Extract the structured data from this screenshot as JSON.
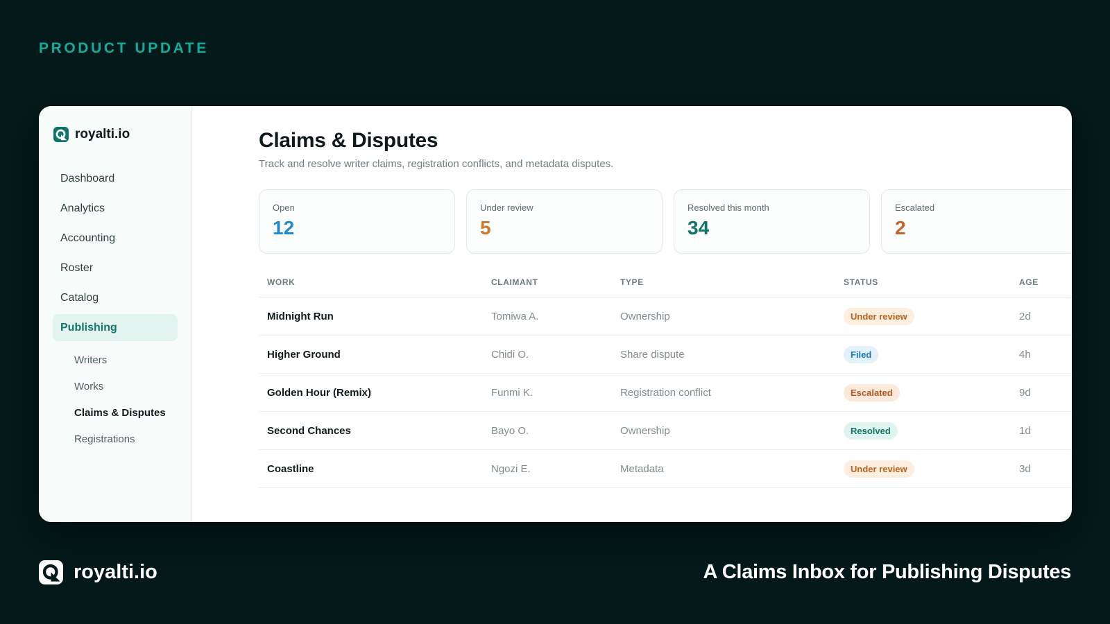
{
  "eyebrow": "PRODUCT UPDATE",
  "colors": {
    "background": "#04191a",
    "accent": "#14ac9b",
    "open": "#2189cf",
    "under_review": "#d0782b",
    "resolved": "#0f7469",
    "escalated": "#c2672e"
  },
  "brand": {
    "name": "royalti.io",
    "logo_icon": "brand-logo-icon"
  },
  "sidebar": {
    "items": [
      {
        "label": "Dashboard"
      },
      {
        "label": "Analytics"
      },
      {
        "label": "Accounting"
      },
      {
        "label": "Roster"
      },
      {
        "label": "Catalog"
      },
      {
        "label": "Publishing",
        "active": true
      }
    ],
    "subitems": [
      {
        "label": "Writers"
      },
      {
        "label": "Works"
      },
      {
        "label": "Claims & Disputes",
        "current": true
      },
      {
        "label": "Registrations"
      }
    ]
  },
  "page": {
    "title": "Claims & Disputes",
    "subtitle": "Track and resolve writer claims, registration conflicts, and metadata disputes."
  },
  "stats": [
    {
      "label": "Open",
      "value": "12"
    },
    {
      "label": "Under review",
      "value": "5"
    },
    {
      "label": "Resolved this month",
      "value": "34"
    },
    {
      "label": "Escalated",
      "value": "2"
    }
  ],
  "table": {
    "headers": {
      "work": "WORK",
      "claimant": "CLAIMANT",
      "type": "TYPE",
      "status": "STATUS",
      "age": "AGE"
    },
    "rows": [
      {
        "work": "Midnight Run",
        "claimant": "Tomiwa A.",
        "type": "Ownership",
        "status": "Under review",
        "age": "2d"
      },
      {
        "work": "Higher Ground",
        "claimant": "Chidi O.",
        "type": "Share dispute",
        "status": "Filed",
        "age": "4h"
      },
      {
        "work": "Golden Hour (Remix)",
        "claimant": "Funmi K.",
        "type": "Registration conflict",
        "status": "Escalated",
        "age": "9d"
      },
      {
        "work": "Second Chances",
        "claimant": "Bayo O.",
        "type": "Ownership",
        "status": "Resolved",
        "age": "1d"
      },
      {
        "work": "Coastline",
        "claimant": "Ngozi E.",
        "type": "Metadata",
        "status": "Under review",
        "age": "3d"
      }
    ]
  },
  "footer": {
    "brand_name": "royalti.io",
    "tagline": "A Claims Inbox for Publishing Disputes"
  }
}
